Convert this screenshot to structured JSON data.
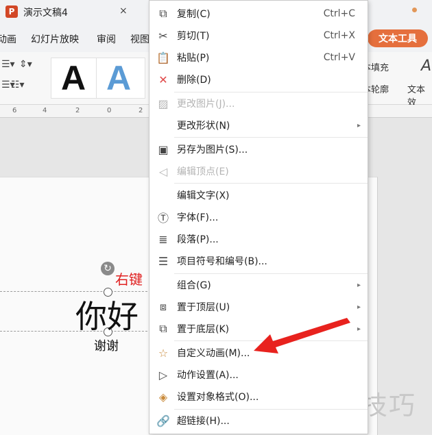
{
  "window": {
    "title": "演示文稿4",
    "close_glyph": "×",
    "app_logo": "P"
  },
  "menubar": {
    "items": [
      "动画",
      "幻灯片放映",
      "审阅",
      "视图"
    ],
    "context_tab": "文本工具"
  },
  "ribbon": {
    "wordart_letter": "A",
    "text_fill": "本填充",
    "text_outline": "本轮廓",
    "text_effect": "文本效"
  },
  "ruler": {
    "labels": [
      "6",
      "4",
      "2",
      "0",
      "2"
    ]
  },
  "slide": {
    "title_text": "你好",
    "subtitle_text": "谢谢",
    "annotation": "右键"
  },
  "watermark": "软件技巧",
  "context_menu": {
    "items": [
      {
        "label": "复制(C)",
        "shortcut": "Ctrl+C",
        "icon": "copy-icon",
        "enabled": true
      },
      {
        "label": "剪切(T)",
        "shortcut": "Ctrl+X",
        "icon": "scissors-icon",
        "enabled": true
      },
      {
        "label": "粘贴(P)",
        "shortcut": "Ctrl+V",
        "icon": "paste-icon",
        "enabled": true
      },
      {
        "label": "删除(D)",
        "shortcut": "",
        "icon": "delete-icon",
        "enabled": true
      },
      {
        "label": "更改图片(J)...",
        "shortcut": "",
        "icon": "change-picture-icon",
        "enabled": false
      },
      {
        "label": "更改形状(N)",
        "shortcut": "",
        "icon": "",
        "enabled": true,
        "submenu": true
      },
      {
        "label": "另存为图片(S)...",
        "shortcut": "",
        "icon": "save-as-picture-icon",
        "enabled": true
      },
      {
        "label": "编辑顶点(E)",
        "shortcut": "",
        "icon": "edit-points-icon",
        "enabled": false
      },
      {
        "label": "编辑文字(X)",
        "shortcut": "",
        "icon": "",
        "enabled": true
      },
      {
        "label": "字体(F)...",
        "shortcut": "",
        "icon": "font-icon",
        "enabled": true
      },
      {
        "label": "段落(P)...",
        "shortcut": "",
        "icon": "paragraph-icon",
        "enabled": true
      },
      {
        "label": "项目符号和编号(B)...",
        "shortcut": "",
        "icon": "bullets-icon",
        "enabled": true
      },
      {
        "label": "组合(G)",
        "shortcut": "",
        "icon": "",
        "enabled": true,
        "submenu": true
      },
      {
        "label": "置于顶层(U)",
        "shortcut": "",
        "icon": "bring-to-front-icon",
        "enabled": true,
        "submenu": true
      },
      {
        "label": "置于底层(K)",
        "shortcut": "",
        "icon": "send-to-back-icon",
        "enabled": true,
        "submenu": true
      },
      {
        "label": "自定义动画(M)...",
        "shortcut": "",
        "icon": "custom-animation-icon",
        "enabled": true
      },
      {
        "label": "动作设置(A)...",
        "shortcut": "",
        "icon": "action-settings-icon",
        "enabled": true
      },
      {
        "label": "设置对象格式(O)...",
        "shortcut": "",
        "icon": "format-object-icon",
        "enabled": true
      },
      {
        "label": "超链接(H)...",
        "shortcut": "",
        "icon": "hyperlink-icon",
        "enabled": true
      }
    ]
  },
  "colors": {
    "accent_orange": "#e56f3d",
    "annotation_red": "#e02020",
    "arrow_red": "#e8221e",
    "wordart_blue": "#5b9bd5"
  }
}
